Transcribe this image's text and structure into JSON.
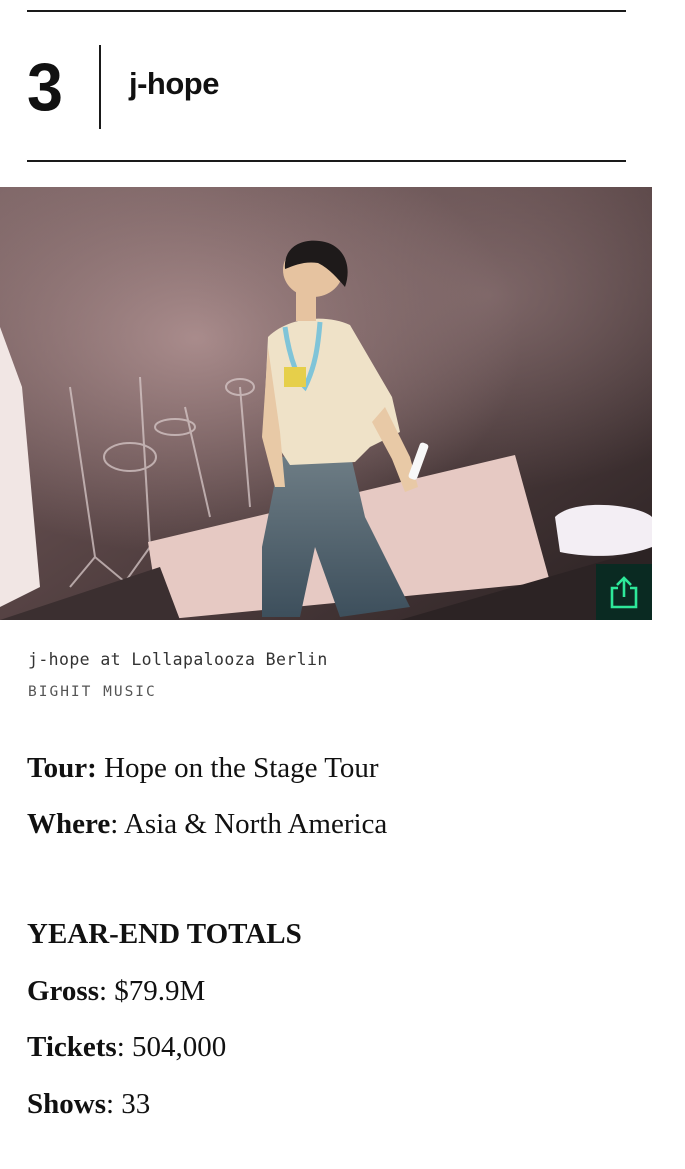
{
  "ranking": {
    "rank": "3",
    "artist": "j-hope"
  },
  "photo": {
    "caption": "j-hope at Lollapalooza Berlin",
    "credit": "BIGHIT MUSIC",
    "share_icon": "share-icon"
  },
  "tour_info": {
    "tour_label": "Tour:",
    "tour_value": " Hope on the Stage Tour",
    "where_label": "Where",
    "where_value": ": Asia & North America"
  },
  "totals": {
    "heading": "YEAR-END TOTALS",
    "gross_label": "Gross",
    "gross_value": ": $79.9M",
    "tickets_label": "Tickets",
    "tickets_value": ": 504,000",
    "shows_label": "Shows",
    "shows_value": ": 33"
  },
  "colors": {
    "share_accent": "#2ee89a",
    "share_bg": "#0a2a22",
    "rule": "#1a1a1a"
  }
}
